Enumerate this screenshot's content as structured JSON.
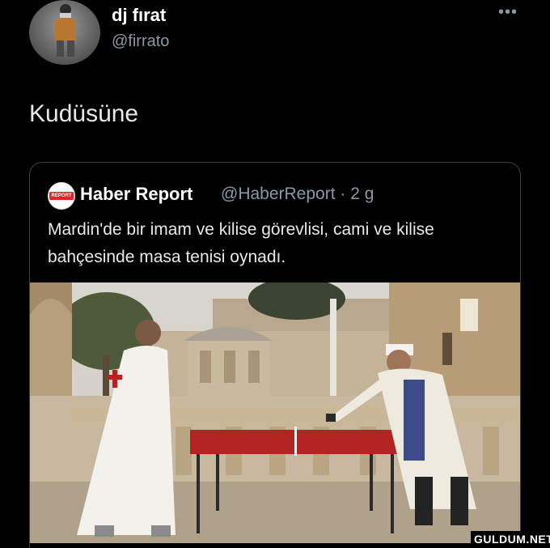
{
  "author": {
    "display_name": "dj fırat",
    "handle": "@firrato",
    "more_icon": "more-horizontal-icon"
  },
  "tweet": {
    "text": "Kudüsüne"
  },
  "quoted_tweet": {
    "logo_text": "REPORT",
    "display_name": "Haber Report",
    "handle_time": "@HaberReport · 2 g",
    "text": "Mardin'de bir imam ve kilise görevlisi, cami ve kilise bahçesinde masa tenisi oynadı."
  },
  "watermark": "GULDUM.NET",
  "colors": {
    "background": "#000000",
    "text_primary": "#e7e9ea",
    "text_secondary": "#8b98a5",
    "card_border": "#3a3f44",
    "report_red": "#e0242a"
  }
}
